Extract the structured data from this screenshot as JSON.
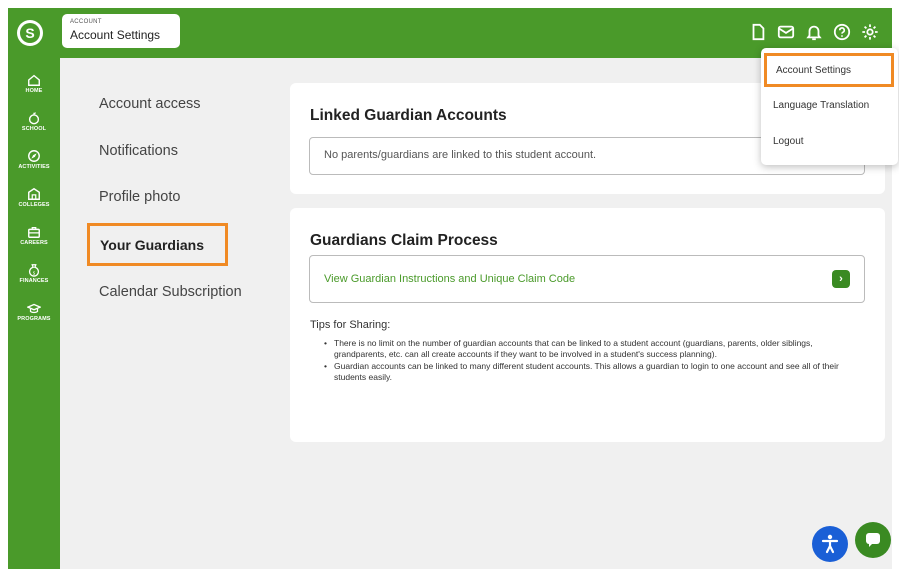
{
  "header": {
    "breadcrumb_small": "ACCOUNT",
    "breadcrumb_title": "Account Settings",
    "logo_letter": "S"
  },
  "sidebar": {
    "items": [
      {
        "label": "HOME",
        "icon": "home-icon"
      },
      {
        "label": "SCHOOL",
        "icon": "apple-icon"
      },
      {
        "label": "ACTIVITIES",
        "icon": "compass-icon"
      },
      {
        "label": "COLLEGES",
        "icon": "building-icon"
      },
      {
        "label": "CAREERS",
        "icon": "briefcase-icon"
      },
      {
        "label": "FINANCES",
        "icon": "money-bag-icon"
      },
      {
        "label": "PROGRAMS",
        "icon": "graduation-cap-icon"
      }
    ]
  },
  "settings_nav": {
    "items": [
      "Account access",
      "Notifications",
      "Profile photo",
      "Your Guardians",
      "Calendar Subscription"
    ],
    "active": "Your Guardians"
  },
  "linked_card": {
    "title": "Linked Guardian Accounts",
    "message": "No parents/guardians are linked to this student account."
  },
  "claim_card": {
    "title": "Guardians Claim Process",
    "link": "View Guardian Instructions and Unique Claim Code",
    "tips_heading": "Tips for Sharing:",
    "tips": [
      "There is no limit on the number of guardian accounts that can be linked to a student account (guardians, parents, older siblings, grandparents, etc. can all create accounts if they want to be involved in a student's success planning).",
      "Guardian accounts can be linked to many different student accounts. This allows a guardian to login to one account and see all of their students easily."
    ]
  },
  "dropdown": {
    "items": [
      "Account Settings",
      "Language Translation",
      "Logout"
    ]
  },
  "colors": {
    "brand_green": "#4a9a2a",
    "highlight_orange": "#f08a24",
    "accessibility_blue": "#1a5fd6"
  }
}
